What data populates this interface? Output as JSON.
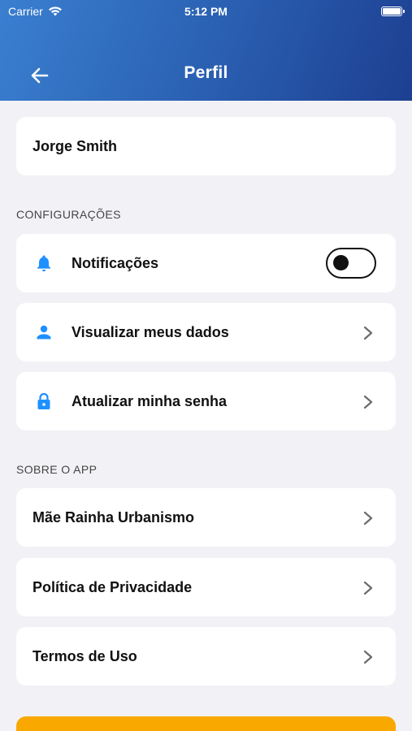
{
  "status_bar": {
    "carrier": "Carrier",
    "time": "5:12 PM"
  },
  "header": {
    "title": "Perfil"
  },
  "profile": {
    "name": "Jorge Smith"
  },
  "sections": {
    "settings_title": "CONFIGURAÇÕES",
    "about_title": "SOBRE O APP"
  },
  "settings": {
    "notifications_label": "Notificações",
    "notifications_enabled": false,
    "view_data_label": "Visualizar meus dados",
    "update_password_label": "Atualizar minha senha"
  },
  "about": {
    "company_label": "Mãe Rainha Urbanismo",
    "privacy_label": "Política de Privacidade",
    "terms_label": "Termos de Uso"
  },
  "colors": {
    "accent_blue": "#1e90ff",
    "header_gradient_start": "#3a7fd0",
    "header_gradient_end": "#1d3f91",
    "bottom_button": "#f9a800"
  },
  "icons": {
    "back": "arrow-left-icon",
    "notifications": "bell-icon",
    "view_data": "person-icon",
    "password": "lock-icon",
    "row_chevron": "chevron-right-icon"
  }
}
